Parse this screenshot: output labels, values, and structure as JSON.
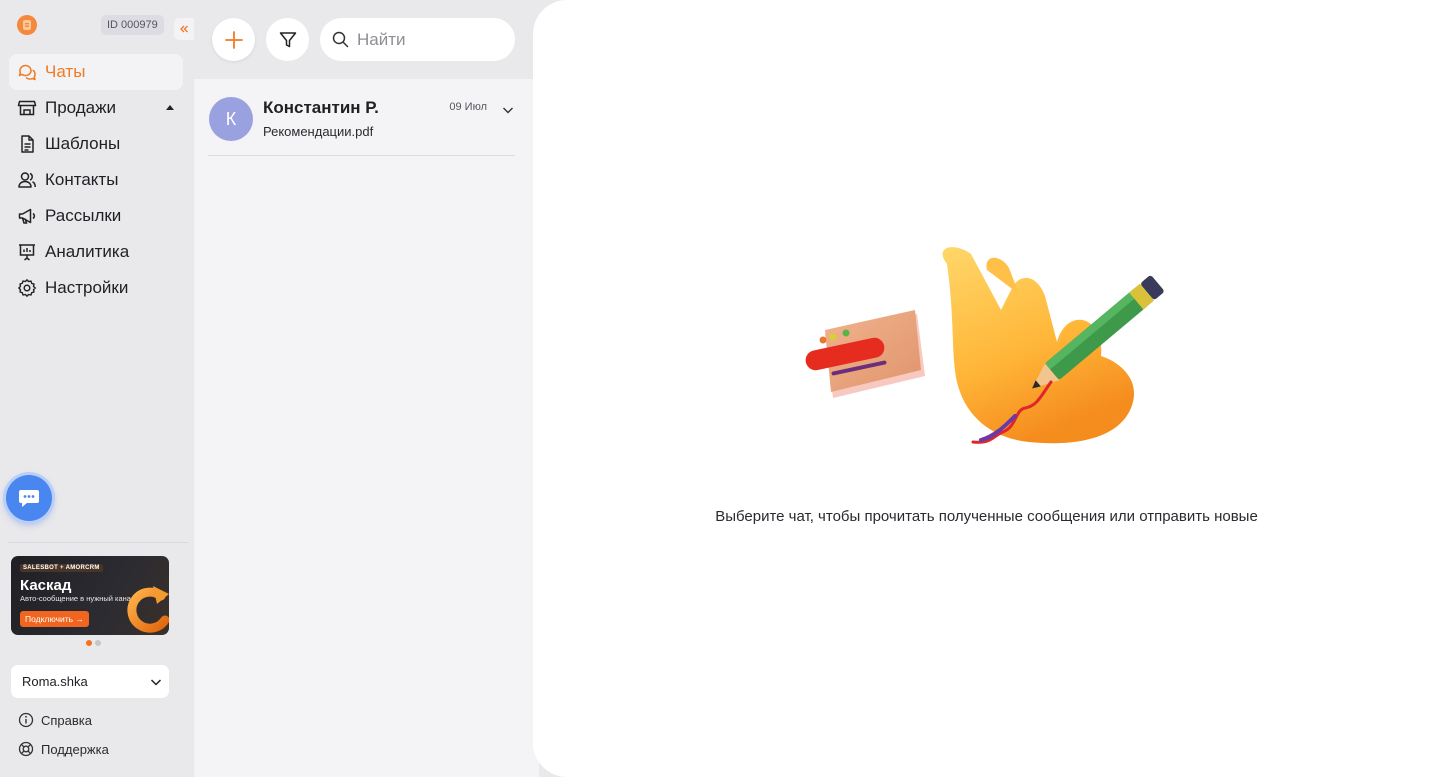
{
  "app": {
    "account_id": "ID 000979"
  },
  "sidebar": {
    "items": [
      {
        "label": "Чаты",
        "icon": "chat-bubbles-icon",
        "active": true
      },
      {
        "label": "Продажи",
        "icon": "store-icon",
        "expandable": true
      },
      {
        "label": "Шаблоны",
        "icon": "document-icon"
      },
      {
        "label": "Контакты",
        "icon": "users-icon"
      },
      {
        "label": "Рассылки",
        "icon": "megaphone-icon"
      },
      {
        "label": "Аналитика",
        "icon": "presentation-chart-icon"
      },
      {
        "label": "Настройки",
        "icon": "gear-icon"
      }
    ],
    "promo": {
      "tag": "SALESBOT + AMORCRM",
      "title": "Каскад",
      "subtitle": "Авто-сообщение в нужный канал",
      "button": "Подключить →"
    },
    "account_select": "Roma.shka",
    "footer": {
      "help": "Справка",
      "support": "Поддержка"
    }
  },
  "chat_list": {
    "search_placeholder": "Найти",
    "chats": [
      {
        "avatar_letter": "К",
        "name": "Константин Р.",
        "preview": "Рекомендации.pdf",
        "date": "09 Июл"
      }
    ]
  },
  "main": {
    "empty_state_text": "Выберите чат, чтобы прочитать полученные сообщения или отправить новые"
  },
  "colors": {
    "accent": "#f07a22",
    "fab": "#4a86f0",
    "avatar": "#9aa1e0"
  }
}
